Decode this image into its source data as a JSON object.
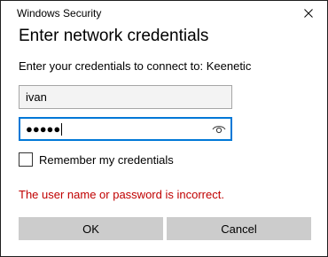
{
  "window": {
    "title": "Windows Security",
    "close_icon": "close-icon"
  },
  "dialog": {
    "heading": "Enter network credentials",
    "prompt": "Enter your credentials to connect to: Keenetic"
  },
  "username": {
    "value": "ivan"
  },
  "password": {
    "masked_value": "●●●●●",
    "reveal_icon": "eye-icon",
    "focused": true
  },
  "remember": {
    "label": "Remember my credentials",
    "checked": false
  },
  "error": {
    "message": "The user name or password is incorrect.",
    "color": "#c00000"
  },
  "buttons": {
    "ok_label": "OK",
    "cancel_label": "Cancel"
  },
  "colors": {
    "focus_border": "#0078d7",
    "button_bg": "#cccccc"
  }
}
